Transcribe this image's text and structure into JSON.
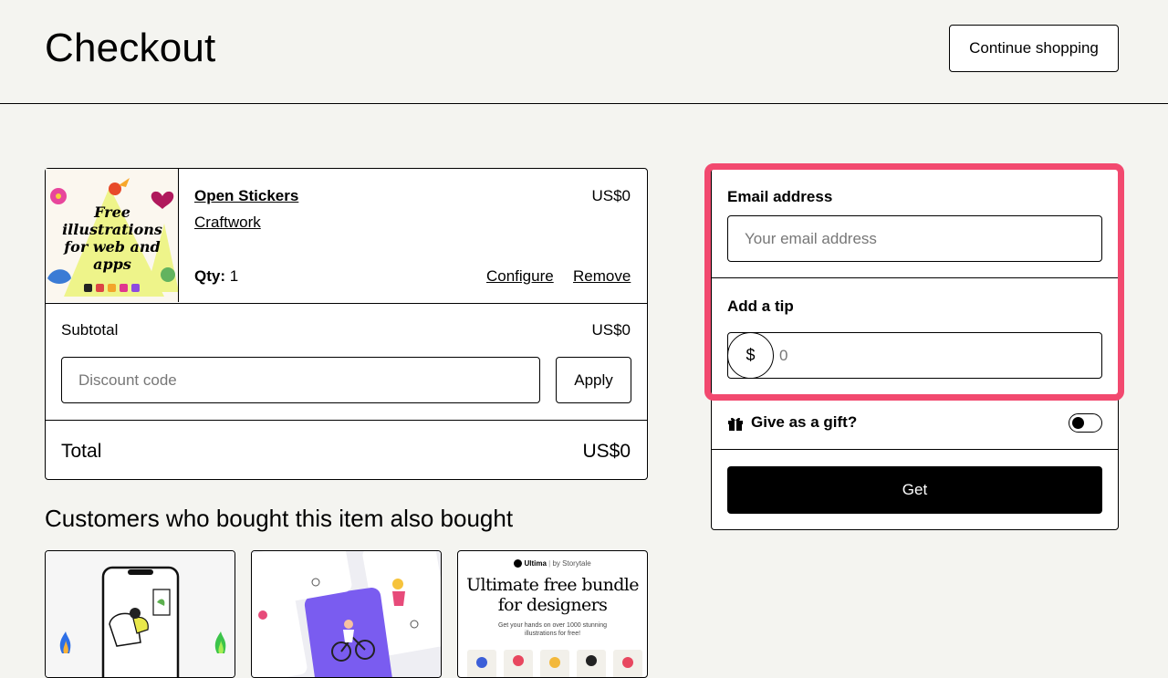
{
  "header": {
    "title": "Checkout",
    "continue_label": "Continue shopping"
  },
  "cart": {
    "item": {
      "name": "Open Stickers",
      "creator": "Craftwork",
      "price": "US$0",
      "qty_label": "Qty:",
      "qty_value": "1",
      "configure_label": "Configure",
      "remove_label": "Remove",
      "thumbnail_text": [
        "Free",
        "illustrations",
        "for web and",
        "apps"
      ]
    },
    "subtotal_label": "Subtotal",
    "subtotal_value": "US$0",
    "discount_placeholder": "Discount code",
    "apply_label": "Apply",
    "total_label": "Total",
    "total_value": "US$0"
  },
  "recommendations": {
    "title": "Customers who bought this item also bought",
    "card3": {
      "brand": "Ultima",
      "brand_suffix": "by Storytale",
      "headline_line1": "Ultimate free bundle",
      "headline_line2": "for designers",
      "sub_line1": "Get your hands on over 1000 stunning",
      "sub_line2": "illustrations for free!"
    }
  },
  "checkout_panel": {
    "email_label": "Email address",
    "email_placeholder": "Your email address",
    "tip_label": "Add a tip",
    "tip_currency": "$",
    "tip_placeholder": "0",
    "gift_label": "Give as a gift?",
    "get_label": "Get"
  },
  "colors": {
    "background": "#f4f4f0",
    "highlight": "#f2496f",
    "primary_button": "#000000"
  }
}
